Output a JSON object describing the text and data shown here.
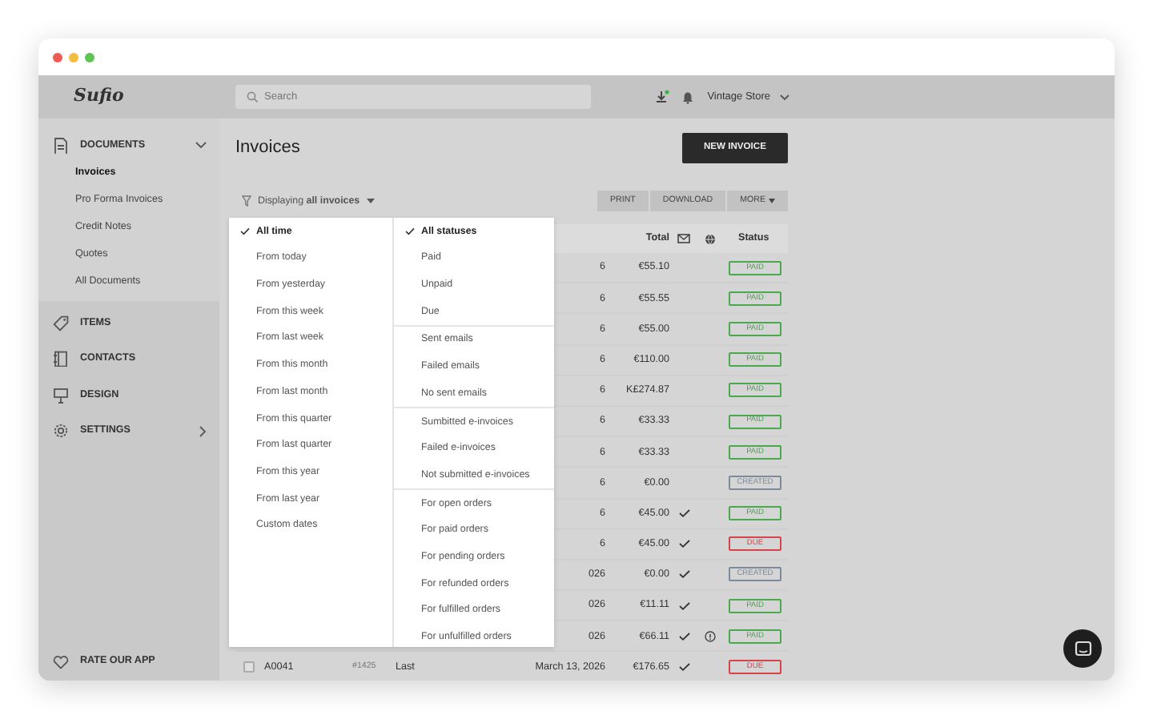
{
  "sidebar": {
    "logo": "Sufio",
    "sections": [
      {
        "label": "DOCUMENTS",
        "kind": "group",
        "expanded": true,
        "children": [
          {
            "label": "Invoices",
            "selected": true
          },
          {
            "label": "Pro Forma Invoices",
            "selected": false
          },
          {
            "label": "Credit Notes",
            "selected": false
          },
          {
            "label": "Quotes",
            "selected": false
          },
          {
            "label": "All Documents",
            "selected": false
          }
        ]
      },
      {
        "label": "ITEMS",
        "kind": "link"
      },
      {
        "label": "CONTACTS",
        "kind": "link"
      },
      {
        "label": "DESIGN",
        "kind": "link"
      },
      {
        "label": "SETTINGS",
        "kind": "group",
        "expanded": false
      }
    ],
    "footer": "RATE OUR APP"
  },
  "header": {
    "search": {
      "placeholder": "Search"
    },
    "download_notification": true,
    "store": "Vintage Store"
  },
  "page": {
    "title": "Invoices",
    "new_button": "NEW INVOICE",
    "filter": "Displaying **all invoices**",
    "actions": [
      {
        "label": "PRINT",
        "kind": "button"
      },
      {
        "label": "DOWNLOAD",
        "kind": "button"
      },
      {
        "label": "MORE",
        "kind": "dropdown"
      }
    ]
  },
  "table": {
    "columns": {
      "total": "Total",
      "status": "Status"
    },
    "rows": [
      {
        "date": "6",
        "total": "€55.10",
        "emailed": false,
        "warning": false,
        "status": "PAID",
        "kind": "paid"
      },
      {
        "date": "6",
        "total": "€55.55",
        "emailed": false,
        "warning": false,
        "status": "PAID",
        "kind": "paid"
      },
      {
        "date": "6",
        "total": "€55.00",
        "emailed": false,
        "warning": false,
        "status": "PAID",
        "kind": "paid"
      },
      {
        "date": "6",
        "total": "€110.00",
        "emailed": false,
        "warning": false,
        "status": "PAID",
        "kind": "paid"
      },
      {
        "date": "6",
        "total": "K£274.87",
        "emailed": false,
        "warning": false,
        "status": "PAID",
        "kind": "paid"
      },
      {
        "date": "6",
        "total": "€33.33",
        "emailed": false,
        "warning": false,
        "status": "PAID",
        "kind": "paid"
      },
      {
        "date": "6",
        "total": "€33.33",
        "emailed": false,
        "warning": false,
        "status": "PAID",
        "kind": "paid"
      },
      {
        "date": "6",
        "total": "€0.00",
        "emailed": false,
        "warning": false,
        "status": "CREATED",
        "kind": "created"
      },
      {
        "date": "6",
        "total": "€45.00",
        "emailed": true,
        "warning": false,
        "status": "PAID",
        "kind": "paid"
      },
      {
        "date": "6",
        "total": "€45.00",
        "emailed": true,
        "warning": false,
        "status": "DUE",
        "kind": "due"
      },
      {
        "date": "026",
        "total": "€0.00",
        "emailed": true,
        "warning": false,
        "status": "CREATED",
        "kind": "created"
      },
      {
        "date": "026",
        "total": "€11.11",
        "emailed": true,
        "warning": false,
        "status": "PAID",
        "kind": "paid"
      },
      {
        "date": "026",
        "total": "€66.11",
        "emailed": true,
        "warning": true,
        "status": "PAID",
        "kind": "paid"
      },
      {
        "checked": false,
        "number": "A0041",
        "order": "#1425",
        "customer": "Last",
        "date": "March 13, 2026",
        "total": "€176.65",
        "emailed": true,
        "warning": false,
        "status": "DUE",
        "kind": "due"
      }
    ]
  },
  "filter_menu": {
    "date_options": [
      {
        "label": "All time",
        "selected": true
      },
      {
        "label": "From today",
        "selected": false
      },
      {
        "label": "From yesterday",
        "selected": false
      },
      {
        "label": "From this week",
        "selected": false
      },
      {
        "label": "From last week",
        "selected": false
      },
      {
        "label": "From this month",
        "selected": false
      },
      {
        "label": "From last month",
        "selected": false
      },
      {
        "label": "From this quarter",
        "selected": false
      },
      {
        "label": "From last quarter",
        "selected": false
      },
      {
        "label": "From this year",
        "selected": false
      },
      {
        "label": "From last year",
        "selected": false
      },
      {
        "label": "Custom dates",
        "selected": false
      }
    ],
    "status_groups": [
      [
        {
          "label": "All statuses",
          "selected": true
        },
        {
          "label": "Paid",
          "selected": false
        },
        {
          "label": "Unpaid",
          "selected": false
        },
        {
          "label": "Due",
          "selected": false
        }
      ],
      [
        {
          "label": "Sent emails",
          "selected": false
        },
        {
          "label": "Failed emails",
          "selected": false
        },
        {
          "label": "No sent emails",
          "selected": false
        }
      ],
      [
        {
          "label": "Sumbitted e-invoices",
          "selected": false
        },
        {
          "label": "Failed e-invoices",
          "selected": false
        },
        {
          "label": "Not submitted e-invoices",
          "selected": false
        }
      ],
      [
        {
          "label": "For open orders",
          "selected": false
        },
        {
          "label": "For paid orders",
          "selected": false
        },
        {
          "label": "For pending orders",
          "selected": false
        },
        {
          "label": "For refunded orders",
          "selected": false
        },
        {
          "label": "For fulfilled orders",
          "selected": false
        },
        {
          "label": "For unfulfilled orders",
          "selected": false
        }
      ]
    ]
  }
}
